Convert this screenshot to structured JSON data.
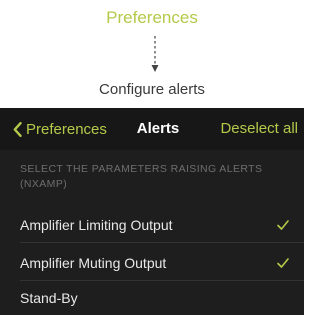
{
  "colors": {
    "accent": "#b6c94a",
    "background": "#1e1e1e",
    "navbar": "#171717",
    "row_text": "#e8e8e8",
    "section_header": "#6e6e6e"
  },
  "flow": {
    "top_label": "Preferences",
    "bottom_label": "Configure alerts"
  },
  "navbar": {
    "back_label": "Preferences",
    "title": "Alerts",
    "action_label": "Deselect all"
  },
  "section": {
    "header": "SELECT THE PARAMETERS RAISING ALERTS (NXAMP)"
  },
  "rows": [
    {
      "label": "Amplifier Limiting Output",
      "checked": true
    },
    {
      "label": "Amplifier Muting Output",
      "checked": true
    },
    {
      "label": "Stand-By",
      "checked": false
    }
  ],
  "icons": {
    "back": "chevron-left-icon",
    "check": "checkmark-icon",
    "flow": "dotted-arrow-down-icon"
  }
}
